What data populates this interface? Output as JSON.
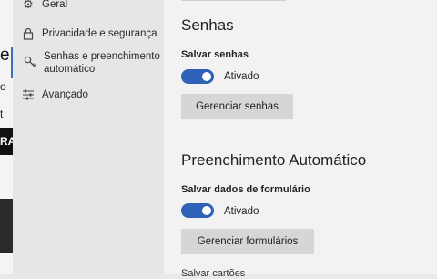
{
  "background_page": {
    "partial_letter": "e",
    "partial_text_1": "o",
    "partial_text_2": "t",
    "banner_text": "RA"
  },
  "nav": {
    "items": [
      {
        "icon": "gear-icon",
        "label": "Geral"
      },
      {
        "icon": "lock-icon",
        "label": "Privacidade e segurança"
      },
      {
        "icon": "key-icon",
        "label": "Senhas e preenchimento automático",
        "active": true
      },
      {
        "icon": "sliders-icon",
        "label": "Avançado"
      }
    ]
  },
  "passwords": {
    "heading": "Senhas",
    "save_label": "Salvar senhas",
    "save_state": "Ativado",
    "manage_button": "Gerenciar senhas"
  },
  "autofill": {
    "heading": "Preenchimento Automático",
    "save_label": "Salvar dados de formulário",
    "save_state": "Ativado",
    "manage_button": "Gerenciar formulários",
    "next_label_partial": "Salvar cartões"
  },
  "colors": {
    "accent": "#2f61b8"
  }
}
